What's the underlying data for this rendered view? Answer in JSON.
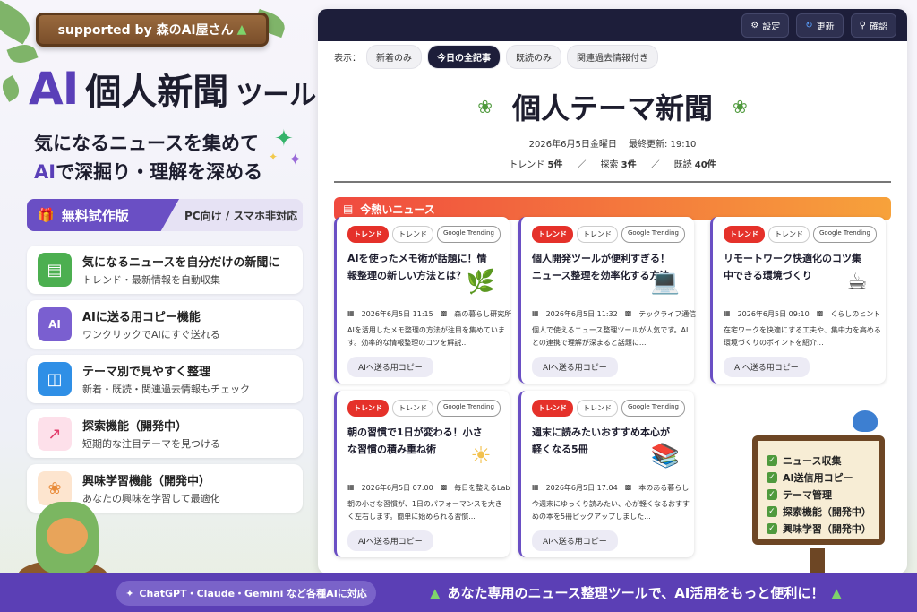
{
  "header_sign": {
    "text": "supported by 森のAI屋さん",
    "icon": "tree-icon"
  },
  "hero": {
    "ai": "AI",
    "rest": "個人新聞",
    "tool": "ツール"
  },
  "tagline": {
    "line1": "気になるニュースを集めて",
    "line2_hl": "AI",
    "line2_rest": "で深掘り・理解を深める"
  },
  "trial": {
    "label": "無料試作版",
    "note": "PC向け / スマホ非対応"
  },
  "features": [
    {
      "title": "気になるニュースを自分だけの新聞に",
      "desc": "トレンド・最新情報を自動収集",
      "icon": "newspaper-icon"
    },
    {
      "title": "AIに送る用コピー機能",
      "desc": "ワンクリックでAIにすぐ送れる",
      "icon": "ai-chat-icon"
    },
    {
      "title": "テーマ別で見やすく整理",
      "desc": "新着・既読・関連過去情報もチェック",
      "icon": "folder-icon"
    },
    {
      "title": "探索機能（開発中）",
      "desc": "短期的な注目テーマを見つける",
      "icon": "trend-up-icon"
    },
    {
      "title": "興味学習機能（開発中）",
      "desc": "あなたの興味を学習して最適化",
      "icon": "brain-icon"
    }
  ],
  "app": {
    "toolbar": {
      "settings": "設定",
      "refresh": "更新",
      "confirm": "確認"
    },
    "filter_label": "表示：",
    "filters": [
      "新着のみ",
      "今日の全記事",
      "既読のみ",
      "関連過去情報付き"
    ],
    "active_filter": "今日の全記事",
    "title": "個人テーマ新聞",
    "date_line": "2026年6月5日金曜日　 最終更新: 19:10",
    "stats": {
      "trend_label": "トレンド",
      "trend": "5件",
      "explore_label": "探索",
      "explore": "3件",
      "read_label": "既読",
      "read": "40件",
      "sep": "／"
    },
    "hot_label": "今熱いニュース",
    "articles": [
      {
        "tag1": "トレンド",
        "tag2": "トレンド",
        "tag3": "Google Trending",
        "title": "AIを使ったメモ術が話題に！情報整理の新しい方法とは？",
        "date": "2026年6月5日 11:15",
        "source": "森の暮らし研究所",
        "desc": "AIを活用したメモ整理の方法が注目を集めています。効率的な情報整理のコツを解説...",
        "button": "AIへ送る用コピー",
        "illust": "🌿"
      },
      {
        "tag1": "トレンド",
        "tag2": "トレンド",
        "tag3": "Google Trending",
        "title": "個人開発ツールが便利すぎる！ニュース整理を効率化する方法",
        "date": "2026年6月5日 11:32",
        "source": "テックライフ通信",
        "desc": "個人で使えるニュース整理ツールが人気です。AIとの連携で理解が深まると話題に...",
        "button": "AIへ送る用コピー",
        "illust": "💻"
      },
      {
        "tag1": "トレンド",
        "tag2": "トレンド",
        "tag3": "Google Trending",
        "title": "リモートワーク快適化のコツ集中できる環境づくり",
        "date": "2026年6月5日 09:10",
        "source": "くらしのヒント",
        "desc": "在宅ワークを快適にする工夫や、集中力を高める環境づくりのポイントを紹介...",
        "button": "AIへ送る用コピー",
        "illust": "☕"
      },
      {
        "tag1": "トレンド",
        "tag2": "トレンド",
        "tag3": "Google Trending",
        "title": "朝の習慣で1日が変わる！小さな習慣の積み重ね術",
        "date": "2026年6月5日 07:00",
        "source": "毎日を整えるLab",
        "desc": "朝の小さな習慣が、1日のパフォーマンスを大きく左右します。簡単に始められる習慣...",
        "button": "AIへ送る用コピー",
        "illust": "☀"
      },
      {
        "tag1": "トレンド",
        "tag2": "トレンド",
        "tag3": "Google Trending",
        "title": "週末に読みたいおすすめ本心が軽くなる5冊",
        "date": "2026年6月5日 17:04",
        "source": "本のある暮らし",
        "desc": "今週末にゆっくり読みたい、心が軽くなるおすすめの本を5冊ピックアップしました...",
        "button": "AIへ送る用コピー",
        "illust": "📚"
      }
    ]
  },
  "signboard": [
    "ニュース収集",
    "AI送信用コピー",
    "テーマ管理",
    "探索機能（開発中）",
    "興味学習（開発中）"
  ],
  "footer": {
    "left": "ChatGPT・Claude・Gemini など各種AIに対応",
    "right": "あなた専用のニュース整理ツールで、AI活用をもっと便利に！"
  }
}
